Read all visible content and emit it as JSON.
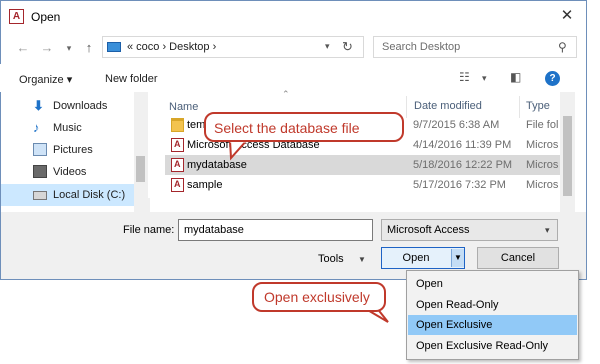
{
  "window": {
    "title": "Open",
    "app_icon_letter": "A",
    "close_label": "✕"
  },
  "address": {
    "path": "«  coco  ›  Desktop  ›",
    "search_placeholder": "Search Desktop"
  },
  "toolbar": {
    "organize_label": "Organize ▾",
    "new_folder_label": "New folder",
    "help_label": "?"
  },
  "nav": {
    "items": [
      {
        "label": "Downloads",
        "icon": "download-icon"
      },
      {
        "label": "Music",
        "icon": "music-icon"
      },
      {
        "label": "Pictures",
        "icon": "pictures-icon"
      },
      {
        "label": "Videos",
        "icon": "videos-icon"
      },
      {
        "label": "Local Disk (C:)",
        "icon": "disk-icon"
      }
    ]
  },
  "filelist": {
    "columns": [
      "Name",
      "Date modified",
      "Type"
    ],
    "rows": [
      {
        "name": "tem",
        "date": "9/7/2015 6:38 AM",
        "type": "File fol",
        "icon": "folder-icon"
      },
      {
        "name": "Microsoft Access Database",
        "date": "4/14/2016 11:39 PM",
        "type": "Micros",
        "icon": "access-file-icon"
      },
      {
        "name": "mydatabase",
        "date": "5/18/2016 12:22 PM",
        "type": "Micros",
        "icon": "access-file-icon"
      },
      {
        "name": "sample",
        "date": "5/17/2016 7:32 PM",
        "type": "Micros",
        "icon": "access-file-icon"
      }
    ]
  },
  "bottom": {
    "file_name_label": "File name:",
    "file_name_value": "mydatabase",
    "file_type_value": "Microsoft Access",
    "tools_label": "Tools",
    "open_label": "Open",
    "cancel_label": "Cancel"
  },
  "menu": {
    "items": [
      "Open",
      "Open Read-Only",
      "Open Exclusive",
      "Open Exclusive Read-Only"
    ]
  },
  "callouts": {
    "select_file": "Select the database file",
    "open_exclusively": "Open exclusively"
  },
  "colors": {
    "callout": "#c0392b",
    "selection": "#cce8ff",
    "menu_highlight": "#91c9f7"
  }
}
